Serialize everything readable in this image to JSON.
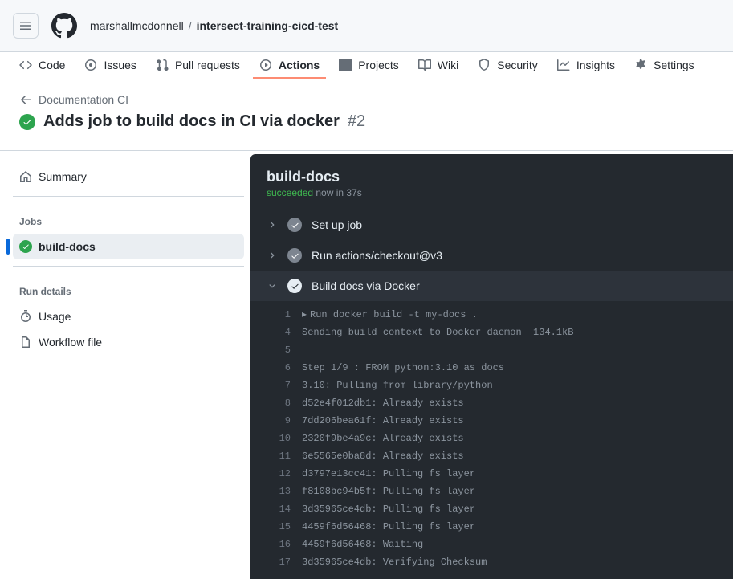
{
  "header": {
    "owner": "marshallmcdonnell",
    "sep": "/",
    "repo": "intersect-training-cicd-test"
  },
  "nav": {
    "code": "Code",
    "issues": "Issues",
    "pulls": "Pull requests",
    "actions": "Actions",
    "projects": "Projects",
    "wiki": "Wiki",
    "security": "Security",
    "insights": "Insights",
    "settings": "Settings"
  },
  "workflow": {
    "back_label": "Documentation CI",
    "title": "Adds job to build docs in CI via docker",
    "run_number": "#2"
  },
  "sidebar": {
    "summary": "Summary",
    "jobs_heading": "Jobs",
    "job_name": "build-docs",
    "details_heading": "Run details",
    "usage": "Usage",
    "workflow_file": "Workflow file"
  },
  "job": {
    "name": "build-docs",
    "status_ok": "succeeded",
    "status_rest": " now in 37s",
    "steps": [
      {
        "label": "Set up job"
      },
      {
        "label": "Run actions/checkout@v3"
      },
      {
        "label": "Build docs via Docker"
      }
    ],
    "log": [
      {
        "n": "1",
        "caret": true,
        "t": "Run docker build -t my-docs ."
      },
      {
        "n": "4",
        "t": "Sending build context to Docker daemon  134.1kB"
      },
      {
        "n": "5",
        "t": ""
      },
      {
        "n": "6",
        "t": "Step 1/9 : FROM python:3.10 as docs"
      },
      {
        "n": "7",
        "t": "3.10: Pulling from library/python"
      },
      {
        "n": "8",
        "t": "d52e4f012db1: Already exists"
      },
      {
        "n": "9",
        "t": "7dd206bea61f: Already exists"
      },
      {
        "n": "10",
        "t": "2320f9be4a9c: Already exists"
      },
      {
        "n": "11",
        "t": "6e5565e0ba8d: Already exists"
      },
      {
        "n": "12",
        "t": "d3797e13cc41: Pulling fs layer"
      },
      {
        "n": "13",
        "t": "f8108bc94b5f: Pulling fs layer"
      },
      {
        "n": "14",
        "t": "3d35965ce4db: Pulling fs layer"
      },
      {
        "n": "15",
        "t": "4459f6d56468: Pulling fs layer"
      },
      {
        "n": "16",
        "t": "4459f6d56468: Waiting"
      },
      {
        "n": "17",
        "t": "3d35965ce4db: Verifying Checksum"
      }
    ]
  }
}
